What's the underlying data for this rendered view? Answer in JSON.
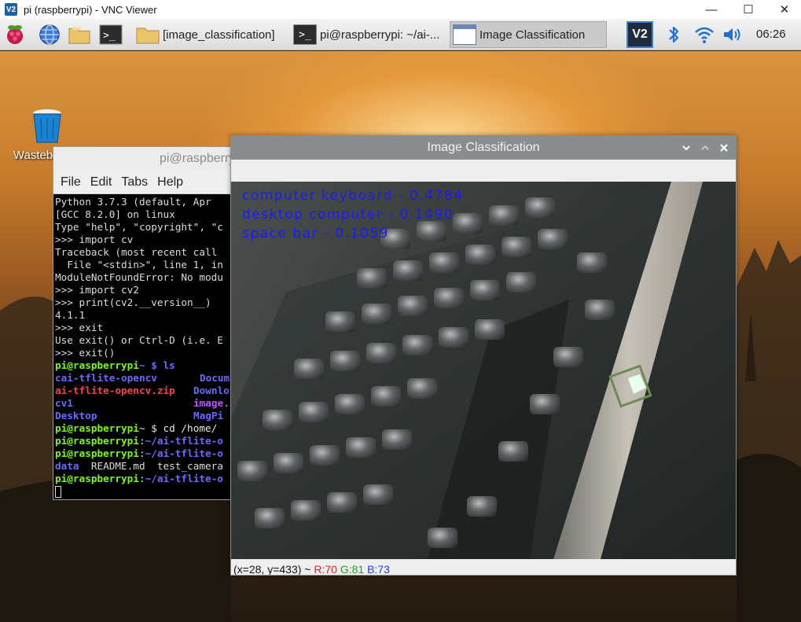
{
  "vnc": {
    "logo": "V2",
    "title": "pi (raspberrypi) - VNC Viewer",
    "minimize": "—",
    "maximize": "☐",
    "close": "✕"
  },
  "taskbar": {
    "tasks": [
      {
        "label": "[image_classification]"
      },
      {
        "label": "pi@raspberrypi: ~/ai-..."
      },
      {
        "label": "Image Classification"
      }
    ],
    "clock": "06:26"
  },
  "desktop": {
    "wastebasket_label": "Wastebasket"
  },
  "terminal": {
    "title": "pi@raspberrypi",
    "menu": [
      "File",
      "Edit",
      "Tabs",
      "Help"
    ],
    "lines": [
      "Python 3.7.3 (default, Apr",
      "[GCC 8.2.0] on linux",
      "Type \"help\", \"copyright\", \"c",
      ">>> import cv",
      "Traceback (most recent call",
      "  File \"<stdin>\", line 1, in",
      "ModuleNotFoundError: No modu",
      ">>> import cv2",
      ">>> print(cv2.__version__)",
      "4.1.1",
      ">>> exit",
      "Use exit() or Ctrl-D (i.e. E",
      ">>> exit()"
    ],
    "prompt_user": "pi@raspberrypi",
    "cmd_ls": "~ $ ls",
    "ls": {
      "cai_tflite_opencv": "cai-tflite-opencv",
      "documents": "Docum",
      "ai_tflite_zip": "ai-tflite-opencv.zip",
      "downloads": "Downlo",
      "cv1": "cv1",
      "image": "image.",
      "desktop": "Desktop",
      "magpi": "MagPi"
    },
    "cmd_cd": "~ $ cd /home/",
    "path1": "~/ai-tflite-o",
    "path2": "~/ai-tflite-o",
    "ls2_data": "data",
    "ls2_rest": "  README.md  test_camera",
    "path3": "~/ai-tflite-o"
  },
  "image_window": {
    "title": "Image Classification",
    "predictions": [
      "computer keyboard - 0.4784",
      "desktop computer - 0.1490",
      "space bar - 0.1059"
    ],
    "status_coords": "(x=28, y=433) ~ ",
    "status_r": "R:70",
    "status_g": "G:81",
    "status_b": "B:73"
  },
  "colors": {
    "prediction_text": "#1a1aff",
    "terminal_prompt": "#7cfc00",
    "terminal_dir": "#6a6aff",
    "terminal_archive": "#ff4040",
    "terminal_image": "#c050ff"
  }
}
